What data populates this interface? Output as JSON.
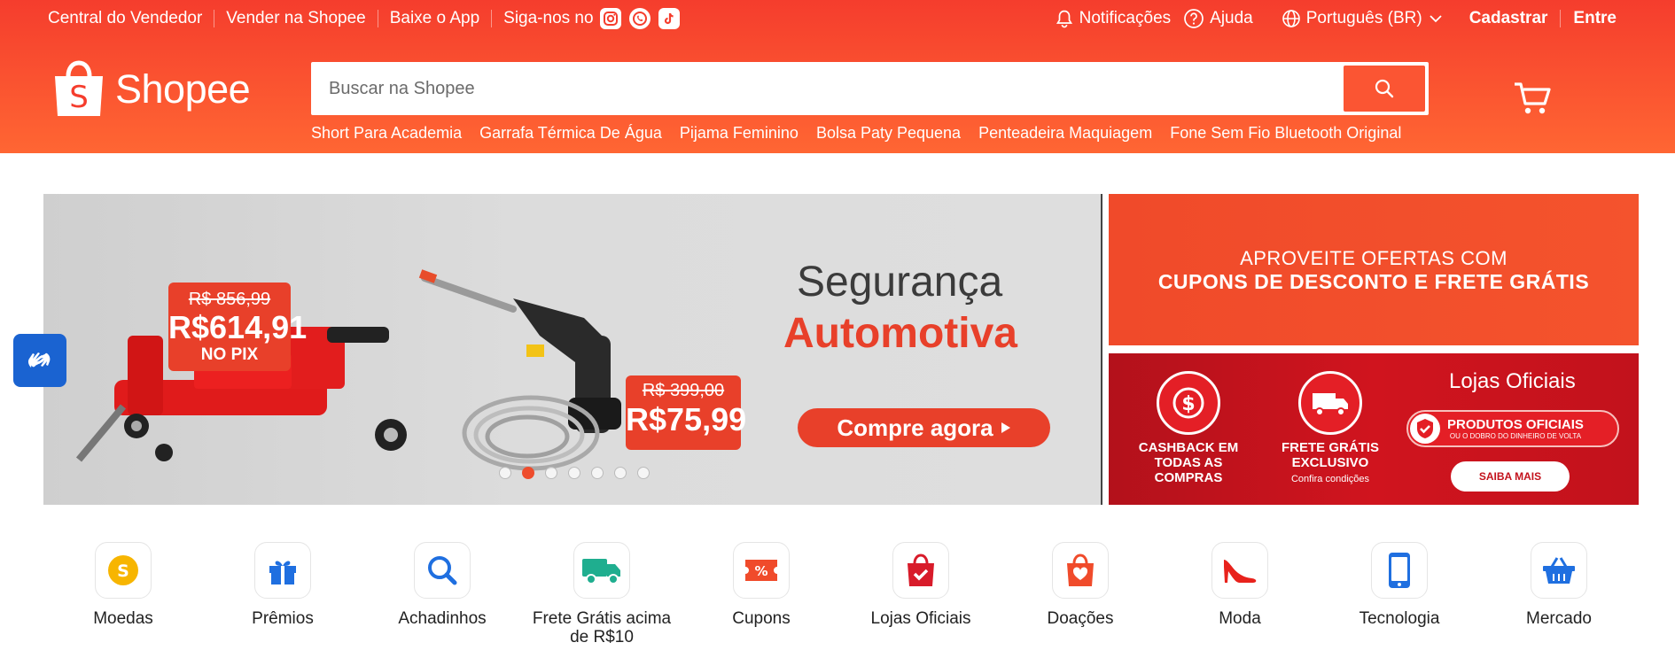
{
  "topbar": {
    "links": [
      "Central do Vendedor",
      "Vender na Shopee",
      "Baixe o App"
    ],
    "follow_label": "Siga-nos no",
    "notifications": "Notificações",
    "help": "Ajuda",
    "language": "Português (BR)",
    "signup": "Cadastrar",
    "login": "Entre"
  },
  "logo": {
    "text": "Shopee"
  },
  "search": {
    "placeholder": "Buscar na Shopee",
    "suggestions": [
      "Short Para Academia",
      "Garrafa Térmica De Água",
      "Pijama Feminino",
      "Bolsa Paty Pequena",
      "Penteadeira Maquiagem",
      "Fone Sem Fio Bluetooth Original"
    ]
  },
  "main_banner": {
    "title_line1": "Segurança",
    "title_line2": "Automotiva",
    "cta": "Compre agora",
    "product1": {
      "old_price": "R$ 856,99",
      "new_price": "R$614,91",
      "note": "NO PIX"
    },
    "product2": {
      "old_price": "R$ 399,00",
      "new_price": "R$75,99"
    },
    "slides_total": 7,
    "active_slide": 2
  },
  "side_banner_top": {
    "line1": "APROVEITE OFERTAS COM",
    "line2": "CUPONS DE DESCONTO E FRETE GRÁTIS"
  },
  "side_banner_bottom": {
    "cashback": "CASHBACK EM TODAS AS COMPRAS",
    "frete_line1": "FRETE GRÁTIS",
    "frete_line2": "EXCLUSIVO",
    "frete_note": "Confira condições",
    "lojas_title": "Lojas Oficiais",
    "pill_title": "PRODUTOS OFICIAIS",
    "pill_sub": "OU O DOBRO DO DINHEIRO DE VOLTA",
    "cta": "SAIBA MAIS"
  },
  "categories": [
    {
      "label": "Moedas",
      "icon": "coin-icon"
    },
    {
      "label": "Prêmios",
      "icon": "gift-icon"
    },
    {
      "label": "Achadinhos",
      "icon": "magnifier-icon"
    },
    {
      "label": "Frete Grátis acima de R$10",
      "icon": "truck-icon"
    },
    {
      "label": "Cupons",
      "icon": "coupon-icon"
    },
    {
      "label": "Lojas Oficiais",
      "icon": "official-bag-icon"
    },
    {
      "label": "Doações",
      "icon": "heart-bag-icon"
    },
    {
      "label": "Moda",
      "icon": "high-heel-icon"
    },
    {
      "label": "Tecnologia",
      "icon": "smartphone-icon"
    },
    {
      "label": "Mercado",
      "icon": "basket-icon"
    }
  ],
  "colors": {
    "brand": "#ee4d2d",
    "accessibility": "#1a63d1"
  }
}
